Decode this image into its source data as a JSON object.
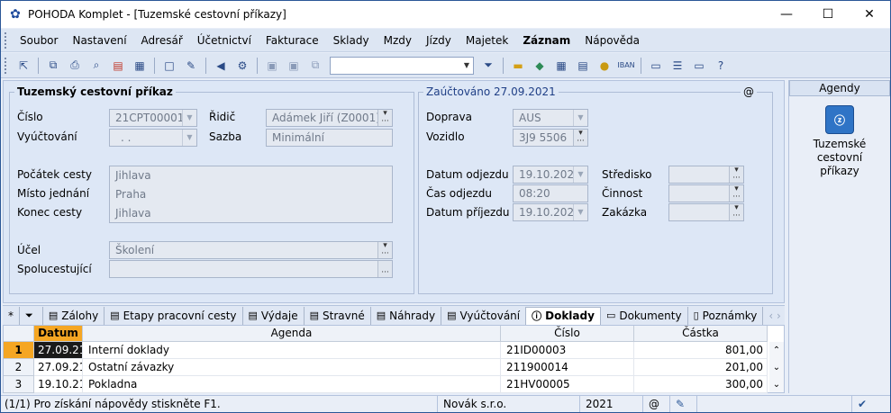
{
  "window": {
    "title": "POHODA Komplet - [Tuzemské cestovní příkazy]",
    "min": "—",
    "max": "☐",
    "close": "✕"
  },
  "menu": [
    "Soubor",
    "Nastavení",
    "Adresář",
    "Účetnictví",
    "Fakturace",
    "Sklady",
    "Mzdy",
    "Jízdy",
    "Majetek",
    "Záznam",
    "Nápověda"
  ],
  "form": {
    "group1_title": "Tuzemský cestovní příkaz",
    "zauctovano": "Zaúčtováno 27.09.2021",
    "at": "@",
    "cislo_label": "Číslo",
    "cislo_value": "21CPT00001",
    "vyuctovani_label": "Vyúčtování",
    "vyuctovani_value": ". .",
    "ridic_label": "Řidič",
    "ridic_value": "Adámek Jiří (Z0001)",
    "sazba_label": "Sazba",
    "sazba_value": "Minimální",
    "pocatek_label": "Počátek cesty",
    "pocatek_value": "Jihlava",
    "misto_label": "Místo jednání",
    "misto_value": "Praha",
    "konec_label": "Konec cesty",
    "konec_value": "Jihlava",
    "ucel_label": "Účel",
    "ucel_value": "Školení",
    "spolu_label": "Spolucestující",
    "spolu_value": "",
    "doprava_label": "Doprava",
    "doprava_value": "AUS",
    "vozidlo_label": "Vozidlo",
    "vozidlo_value": "3J9 5506",
    "dat_odj_label": "Datum odjezdu",
    "dat_odj_value": "19.10.2021",
    "cas_odj_label": "Čas odjezdu",
    "cas_odj_value": "08:20",
    "dat_prij_label": "Datum příjezdu",
    "dat_prij_value": "19.10.2021",
    "stredisko_label": "Středisko",
    "cinnost_label": "Činnost",
    "zakazka_label": "Zakázka"
  },
  "agendy": {
    "header": "Agendy",
    "item_line1": "Tuzemské cestovní",
    "item_line2": "příkazy"
  },
  "tabs": [
    "*",
    "",
    "Zálohy",
    "Etapy pracovní cesty",
    "Výdaje",
    "Stravné",
    "Náhrady",
    "Vyúčtování",
    "Doklady",
    "Dokumenty",
    "Poznámky"
  ],
  "grid": {
    "headers": {
      "datum": "Datum",
      "agenda": "Agenda",
      "cislo": "Číslo",
      "castka": "Částka"
    },
    "rows": [
      {
        "n": "1",
        "datum": "27.09.21",
        "agenda": "Interní doklady",
        "cislo": "21ID00003",
        "castka": "801,00"
      },
      {
        "n": "2",
        "datum": "27.09.21",
        "agenda": "Ostatní závazky",
        "cislo": "211900014",
        "castka": "201,00"
      },
      {
        "n": "3",
        "datum": "19.10.21",
        "agenda": "Pokladna",
        "cislo": "21HV00005",
        "castka": "300,00"
      }
    ]
  },
  "status": {
    "help": "(1/1) Pro získání nápovědy stiskněte F1.",
    "company": "Novák s.r.o.",
    "year": "2021",
    "at": "@"
  },
  "colors": {
    "accent": "#2b5797",
    "selected_date_bg": "#1a1a1a",
    "row_marker": "#f5a623"
  }
}
